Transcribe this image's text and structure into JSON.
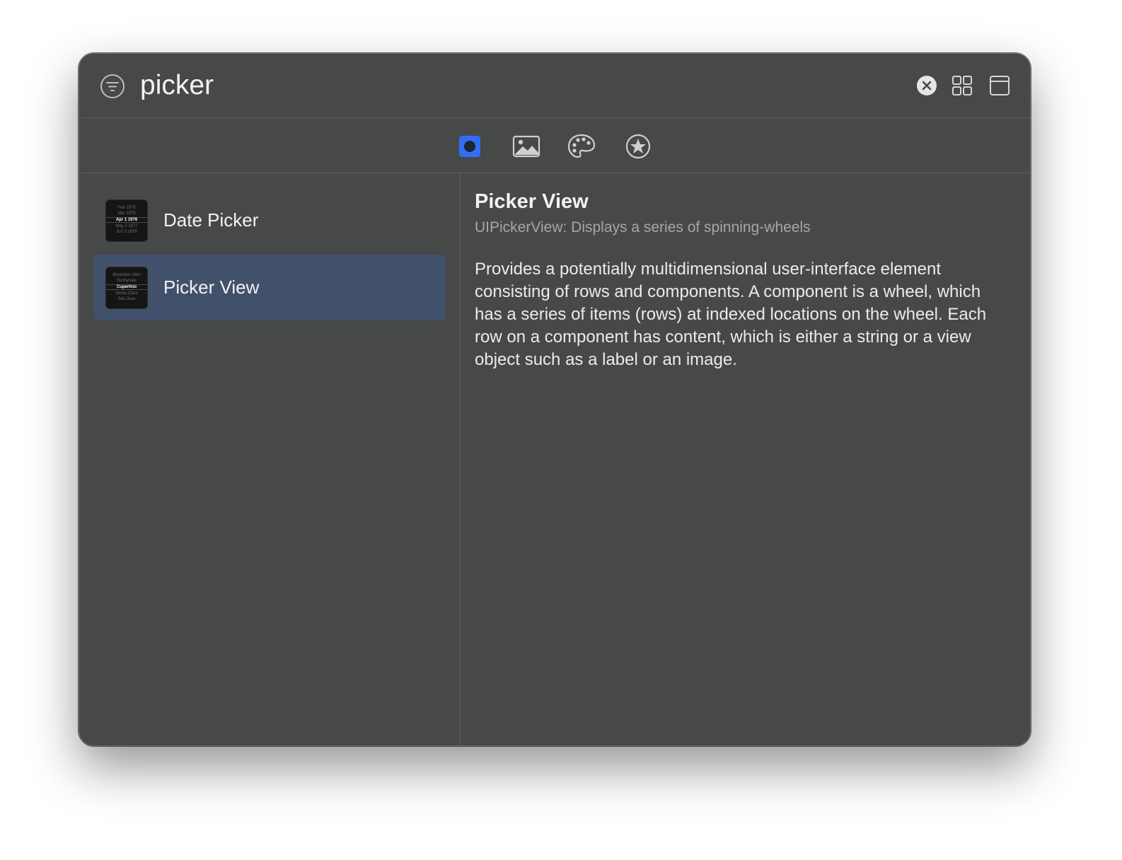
{
  "search": {
    "value": "picker"
  },
  "toolbar": {
    "icons": [
      "filter-icon",
      "clear-icon",
      "grid-view-icon",
      "window-icon"
    ]
  },
  "categories": [
    {
      "name": "objects",
      "icon": "circle-in-square-icon",
      "selected": true
    },
    {
      "name": "media",
      "icon": "photo-icon",
      "selected": false
    },
    {
      "name": "colors",
      "icon": "palette-icon",
      "selected": false
    },
    {
      "name": "favorites",
      "icon": "star-icon",
      "selected": false
    }
  ],
  "colors": {
    "window_bg": "#474848",
    "selected_row": "#42516b",
    "accent": "#2f6ff5"
  },
  "list": {
    "items": [
      {
        "label": "Date Picker",
        "selected": false,
        "thumb": [
          "Feb 1975",
          "Mar 1975",
          "Apr 1 1976",
          "May 2 1977",
          "Jun 3 1978"
        ]
      },
      {
        "label": "Picker View",
        "selected": true,
        "thumb": [
          "Mountain View",
          "Sunnyvale",
          "Cupertino",
          "Santa Clara",
          "San Jose"
        ]
      }
    ]
  },
  "detail": {
    "title": "Picker View",
    "subtitle": "UIPickerView: Displays a series of spinning-wheels",
    "description": "Provides a potentially multidimensional user-interface element consisting of rows and components. A component is a wheel, which has a series of items (rows) at indexed locations on the wheel. Each row on a component has content, which is either a string or a view object such as a label or an image."
  }
}
